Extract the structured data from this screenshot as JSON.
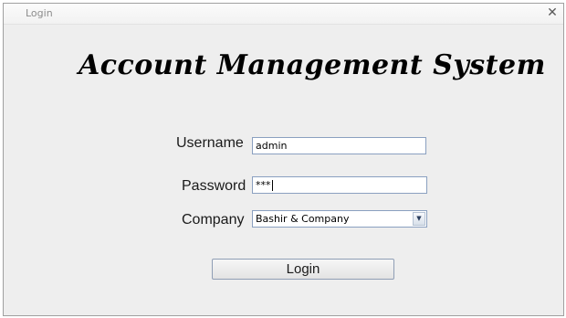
{
  "window": {
    "title": "Login",
    "close_glyph": "✕"
  },
  "app_title": "Account Management System",
  "form": {
    "username_label": "Username",
    "username_value": "admin",
    "password_label": "Password",
    "password_value": "***",
    "company_label": "Company",
    "company_selected": "Bashir & Company",
    "company_arrow": "▼"
  },
  "login_button": "Login",
  "icons": {
    "close": "close-icon",
    "dropdown": "chevron-down-icon"
  },
  "colors": {
    "window_bg": "#eeeeee",
    "field_border": "#8aa0c0",
    "title_text": "#8c8c8c"
  }
}
